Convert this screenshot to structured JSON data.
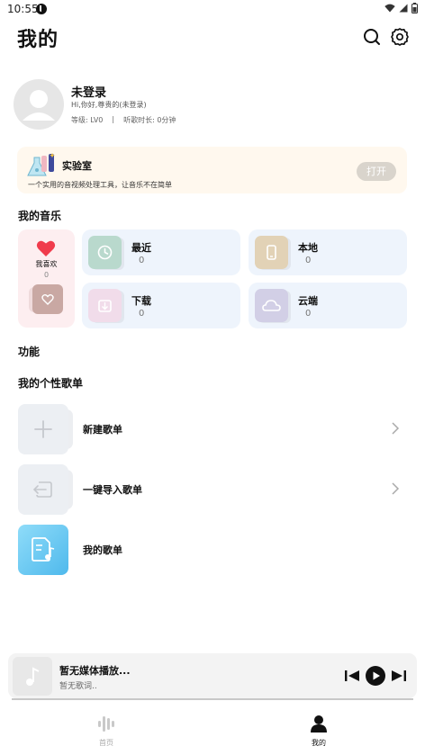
{
  "status": {
    "time": "10:55"
  },
  "header": {
    "title": "我的"
  },
  "profile": {
    "name": "未登录",
    "greeting": "Hi,你好,尊贵的(未登录)",
    "level": "等级: LV0",
    "separator": "|",
    "listen_time": "听歌时长: 0分钟"
  },
  "lab": {
    "title": "实验室",
    "description": "一个实用的音视频处理工具，让音乐不在简单",
    "button": "打开"
  },
  "my_music": {
    "title": "我的音乐",
    "favorites": {
      "label": "我喜欢",
      "count": "0"
    },
    "tiles": [
      {
        "label": "最近",
        "count": "0",
        "icon": "clock-icon",
        "color": "#b9d9cd"
      },
      {
        "label": "本地",
        "count": "0",
        "icon": "phone-icon",
        "color": "#e2d2b6"
      },
      {
        "label": "下载",
        "count": "0",
        "icon": "download-icon",
        "color": "#f1dcea"
      },
      {
        "label": "云端",
        "count": "0",
        "icon": "cloud-icon",
        "color": "#d2cfe6"
      }
    ]
  },
  "functions": {
    "title": "功能"
  },
  "playlists": {
    "title": "我的个性歌单",
    "items": [
      {
        "label": "新建歌单",
        "icon": "plus-icon"
      },
      {
        "label": "一键导入歌单",
        "icon": "import-icon"
      },
      {
        "label": "我的歌单",
        "icon": "music-file-icon"
      }
    ]
  },
  "player": {
    "title": "暂无媒体播放...",
    "lyric": "暂无歌词.."
  },
  "nav": {
    "home": "首页",
    "mine": "我的"
  },
  "colors": {
    "accent": "#222222",
    "heart": "#f03b4c",
    "playlist_accent": "#5bc3f0"
  }
}
